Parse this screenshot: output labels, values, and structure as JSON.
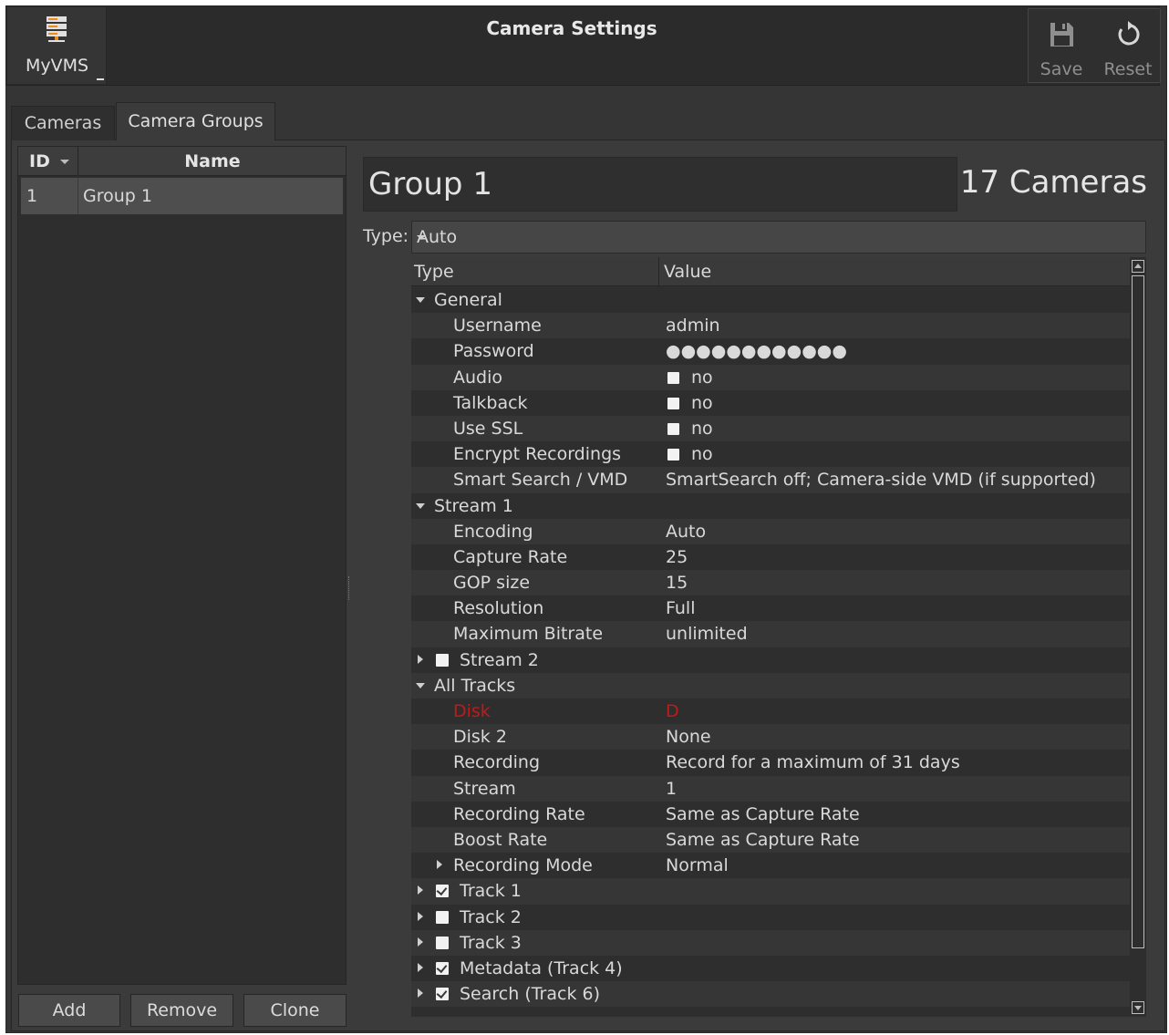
{
  "app": {
    "name": "MyVMS",
    "icon": "server-stack-icon"
  },
  "window": {
    "title": "Camera Settings"
  },
  "toolbar": {
    "save_label": "Save",
    "save_icon": "floppy-disk-icon",
    "reset_label": "Reset",
    "reset_icon": "reset-arrow-icon"
  },
  "tabs": [
    {
      "label": "Cameras",
      "active": false
    },
    {
      "label": "Camera Groups",
      "active": true
    }
  ],
  "group_list": {
    "columns": {
      "id": "ID",
      "name": "Name"
    },
    "rows": [
      {
        "id": "1",
        "name": "Group 1",
        "selected": true
      }
    ]
  },
  "buttons": {
    "add": "Add",
    "remove": "Remove",
    "clone": "Clone"
  },
  "group": {
    "name": "Group 1",
    "camera_count": "17 Cameras"
  },
  "type_field": {
    "label": "Type:",
    "value": "Auto"
  },
  "tree": {
    "columns": {
      "type": "Type",
      "value": "Value"
    },
    "rows": [
      {
        "label": "General",
        "value": "",
        "level": 0,
        "expander": "open"
      },
      {
        "label": "Username",
        "value": "admin",
        "level": 1
      },
      {
        "label": "Password",
        "value": "●●●●●●●●●●●●",
        "level": 1
      },
      {
        "label": "Audio",
        "value": "no",
        "level": 1,
        "value_checkbox": false
      },
      {
        "label": "Talkback",
        "value": "no",
        "level": 1,
        "value_checkbox": false
      },
      {
        "label": "Use SSL",
        "value": "no",
        "level": 1,
        "value_checkbox": false
      },
      {
        "label": "Encrypt Recordings",
        "value": "no",
        "level": 1,
        "value_checkbox": false
      },
      {
        "label": "Smart Search / VMD",
        "value": "SmartSearch off; Camera-side VMD (if supported)",
        "level": 1
      },
      {
        "label": "Stream 1",
        "value": "",
        "level": 0,
        "expander": "open"
      },
      {
        "label": "Encoding",
        "value": "Auto",
        "level": 1
      },
      {
        "label": "Capture Rate",
        "value": "25",
        "level": 1
      },
      {
        "label": "GOP size",
        "value": "15",
        "level": 1
      },
      {
        "label": "Resolution",
        "value": "Full",
        "level": 1
      },
      {
        "label": "Maximum Bitrate",
        "value": "unlimited",
        "level": 1
      },
      {
        "label": "Stream 2",
        "value": "",
        "level": 0,
        "expander": "closed",
        "checkbox": false
      },
      {
        "label": "All Tracks",
        "value": "",
        "level": 0,
        "expander": "open"
      },
      {
        "label": "Disk",
        "value": "D",
        "level": 1,
        "error": true
      },
      {
        "label": "Disk 2",
        "value": "None",
        "level": 1
      },
      {
        "label": "Recording",
        "value": "Record for a maximum of 31 days",
        "level": 1
      },
      {
        "label": "Stream",
        "value": "1",
        "level": 1
      },
      {
        "label": "Recording Rate",
        "value": "Same as Capture Rate",
        "level": 1
      },
      {
        "label": "Boost Rate",
        "value": "Same as Capture Rate",
        "level": 1
      },
      {
        "label": "Recording Mode",
        "value": "Normal",
        "level": 1,
        "expander": "closed"
      },
      {
        "label": "Track 1",
        "value": "",
        "level": 0,
        "expander": "closed",
        "checkbox": true
      },
      {
        "label": "Track 2",
        "value": "",
        "level": 0,
        "expander": "closed",
        "checkbox": false
      },
      {
        "label": "Track 3",
        "value": "",
        "level": 0,
        "expander": "closed",
        "checkbox": false
      },
      {
        "label": "Metadata (Track 4)",
        "value": "",
        "level": 0,
        "expander": "closed",
        "checkbox": true
      },
      {
        "label": "Search (Track 6)",
        "value": "",
        "level": 0,
        "expander": "closed",
        "checkbox": true
      }
    ]
  },
  "colors": {
    "error": "#c01a1a",
    "background": "#353535",
    "selection": "#4e4e4e"
  }
}
